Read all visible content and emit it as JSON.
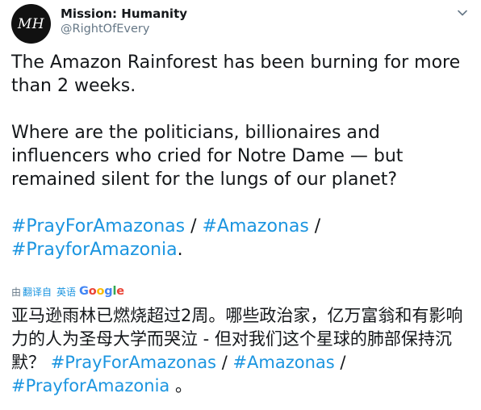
{
  "user": {
    "avatar_initials": "MH",
    "display_name": "Mission: Humanity",
    "handle": "@RightOfEvery"
  },
  "tweet": {
    "line1": "The Amazon Rainforest has been burning for more than 2 weeks.",
    "line2": "Where are the politicians, billionaires and influencers who cried for Notre Dame — but remained silent for the lungs of our planet?",
    "hashtag1": "#PrayForAmazonas",
    "sep1": " / ",
    "hashtag2": "#Amazonas",
    "sep2": " / ",
    "hashtag3": "#PrayforAmazonia",
    "end": "."
  },
  "translation": {
    "prefix": "由",
    "link": "翻译自",
    "language": "英语",
    "provider": "Google",
    "text": "亚马逊雨林已燃烧超过2周。哪些政治家，亿万富翁和有影响力的人为圣母大学而哭泣 - 但对我们这个星球的肺部保持沉默？ ",
    "hashtag1": "#PrayForAmazonas",
    "sep1": " / ",
    "hashtag2": "#Amazonas",
    "sep2": " / ",
    "hashtag3": "#PrayforAmazonia",
    "end": " 。"
  },
  "colors": {
    "link": "#1b95e0",
    "secondary_text": "#657786",
    "primary_text": "#14171a",
    "google_blue": "#4285f4",
    "google_red": "#ea4335",
    "google_yellow": "#fbbc05",
    "google_green": "#34a853"
  },
  "icons": {
    "menu": "chevron-down-icon"
  }
}
